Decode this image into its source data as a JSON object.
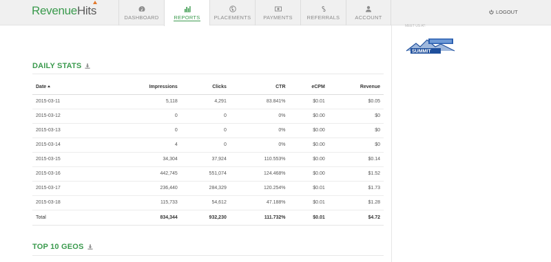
{
  "header": {
    "logo_part1": "Revenue",
    "logo_part2": "Hits",
    "nav": [
      {
        "label": "DASHBOARD",
        "icon": "dashboard-icon"
      },
      {
        "label": "REPORTS",
        "icon": "bar-chart-icon",
        "active": true
      },
      {
        "label": "PLACEMENTS",
        "icon": "globe-icon"
      },
      {
        "label": "PAYMENTS",
        "icon": "money-icon"
      },
      {
        "label": "REFERRALS",
        "icon": "link-icon"
      },
      {
        "label": "ACCOUNT",
        "icon": "user-icon"
      }
    ],
    "logout_label": "LOGOUT"
  },
  "sidebar": {
    "meet_text": "MEET US AT:",
    "banner_text": "SUMMIT"
  },
  "daily_stats": {
    "title": "DAILY STATS",
    "columns": [
      "Date",
      "Impressions",
      "Clicks",
      "CTR",
      "eCPM",
      "Revenue"
    ],
    "rows": [
      [
        "2015-03-11",
        "5,118",
        "4,291",
        "83.841%",
        "$0.01",
        "$0.05"
      ],
      [
        "2015-03-12",
        "0",
        "0",
        "0%",
        "$0.00",
        "$0"
      ],
      [
        "2015-03-13",
        "0",
        "0",
        "0%",
        "$0.00",
        "$0"
      ],
      [
        "2015-03-14",
        "4",
        "0",
        "0%",
        "$0.00",
        "$0"
      ],
      [
        "2015-03-15",
        "34,304",
        "37,924",
        "110.553%",
        "$0.00",
        "$0.14"
      ],
      [
        "2015-03-16",
        "442,745",
        "551,074",
        "124.468%",
        "$0.00",
        "$1.52"
      ],
      [
        "2015-03-17",
        "236,440",
        "284,329",
        "120.254%",
        "$0.01",
        "$1.73"
      ],
      [
        "2015-03-18",
        "115,733",
        "54,612",
        "47.188%",
        "$0.01",
        "$1.28"
      ]
    ],
    "total": [
      "Total",
      "834,344",
      "932,230",
      "111.732%",
      "$0.01",
      "$4.72"
    ]
  },
  "top_geos": {
    "title": "TOP 10 GEOS"
  },
  "colors": {
    "brand_green": "#3a9a4d",
    "logo_accent": "#e2782b",
    "header_bg": "#f0f0f0"
  }
}
